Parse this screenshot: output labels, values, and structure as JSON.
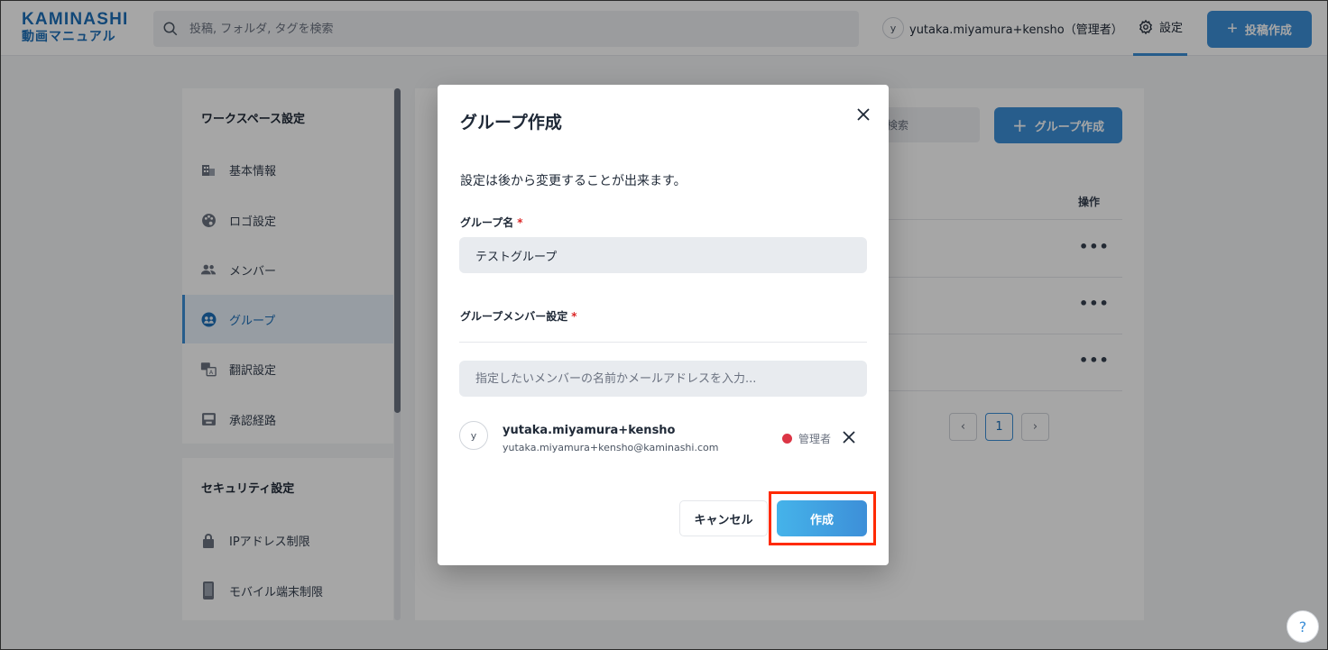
{
  "header": {
    "logo_line1": "KAMINASHI",
    "logo_line2": "動画マニュアル",
    "search_placeholder": "投稿, フォルダ, タグを検索",
    "user_initial": "y",
    "user_label": "yutaka.miyamura+kensho（管理者）",
    "settings_label": "設定",
    "post_button": "投稿作成"
  },
  "sidebar": {
    "workspace_heading": "ワークスペース設定",
    "items": [
      {
        "label": "基本情報",
        "icon": "building-icon"
      },
      {
        "label": "ロゴ設定",
        "icon": "palette-icon"
      },
      {
        "label": "メンバー",
        "icon": "users-icon"
      },
      {
        "label": "グループ",
        "icon": "group-icon",
        "active": true
      },
      {
        "label": "翻訳設定",
        "icon": "translate-icon"
      },
      {
        "label": "承認経路",
        "icon": "inbox-icon"
      }
    ],
    "security_heading": "セキュリティ設定",
    "security_items": [
      {
        "label": "IPアドレス制限",
        "icon": "lock-icon"
      },
      {
        "label": "モバイル端末制限",
        "icon": "phone-icon"
      }
    ]
  },
  "main": {
    "search_placeholder": "検索",
    "add_group_button": "グループ作成",
    "actions_header": "操作",
    "row_menu": "•••",
    "pagination": {
      "prev": "‹",
      "current": "1",
      "next": "›"
    }
  },
  "modal": {
    "title": "グループ作成",
    "description": "設定は後から変更することが出来ます。",
    "group_name_label": "グループ名",
    "required_mark": "*",
    "group_name_value": "テストグループ",
    "member_label": "グループメンバー設定",
    "member_search_placeholder": "指定したいメンバーの名前かメールアドレスを入力...",
    "member": {
      "initial": "y",
      "name": "yutaka.miyamura+kensho",
      "email": "yutaka.miyamura+kensho@kaminashi.com",
      "role": "管理者",
      "role_color": "#dc3545"
    },
    "cancel_button": "キャンセル",
    "create_button": "作成"
  },
  "help_label": "?",
  "colors": {
    "accent": "#3d8fd8",
    "highlight": "#ff2a00"
  }
}
